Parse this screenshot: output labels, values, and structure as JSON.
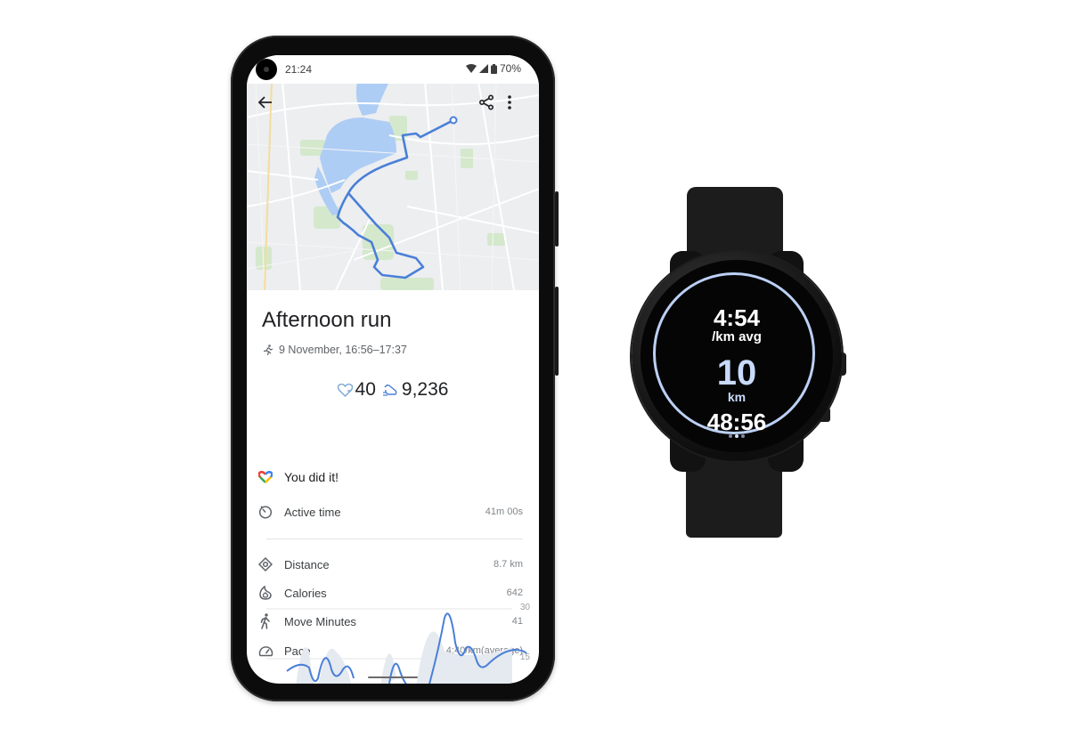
{
  "phone": {
    "status_bar": {
      "time": "21:24",
      "battery": "70%",
      "icons": [
        "wifi-icon",
        "signal-icon",
        "battery-icon"
      ]
    },
    "map_toolbar": {
      "back_icon": "arrow-left-icon",
      "share_icon": "share-icon",
      "more_icon": "more-vert-icon"
    },
    "activity": {
      "title": "Afternoon run",
      "subtitle": "9 November, 16:56–17:37",
      "heart_points": "40",
      "steps": "9,236",
      "goal_message": "You did it!"
    },
    "stats": [
      {
        "icon": "timer-icon",
        "label": "Active time",
        "value": "41m 00s"
      },
      {
        "icon": "distance-icon",
        "label": "Distance",
        "value": "8.7 km"
      },
      {
        "icon": "flame-icon",
        "label": "Calories",
        "value": "642"
      },
      {
        "icon": "walking-icon",
        "label": "Move Minutes",
        "value": "41"
      },
      {
        "icon": "speedometer-icon",
        "label": "Pace",
        "value": "4:40/km(average)"
      }
    ],
    "pace_chart": {
      "type": "line",
      "yticks": [
        "30",
        "15"
      ],
      "ylim": [
        15,
        30
      ]
    },
    "colors": {
      "accent": "#4a7fd8",
      "route": "#4a7fd8",
      "water": "#aecdf5",
      "park": "#cfe6c5"
    }
  },
  "watch": {
    "pace": "4:54",
    "pace_unit": "/km avg",
    "distance": "10",
    "distance_unit": "km",
    "duration": "48:56",
    "ring_color": "#bcd0f5"
  }
}
